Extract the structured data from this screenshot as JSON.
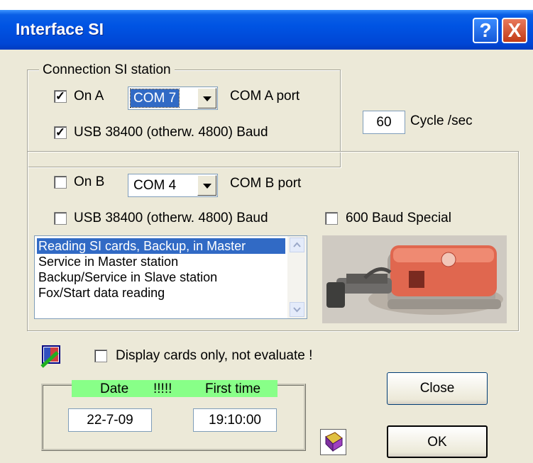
{
  "window": {
    "title": "Interface SI"
  },
  "titlebar_buttons": {
    "help": "?",
    "close": "X"
  },
  "station_group": {
    "label": "Connection SI station"
  },
  "port_a": {
    "checkbox_label": "On A",
    "checked": true,
    "port_value": "COM 7",
    "port_label": "COM A port",
    "usb_label": "USB 38400 (otherw. 4800) Baud",
    "usb_checked": true
  },
  "cycle": {
    "value": "60",
    "label": "Cycle /sec"
  },
  "port_b": {
    "checkbox_label": "On B",
    "checked": false,
    "port_value": "COM 4",
    "port_label": "COM B port",
    "usb_label": "USB 38400 (otherw. 4800) Baud",
    "usb_checked": false,
    "special_label": "600 Baud Special",
    "special_checked": false
  },
  "mode_list": {
    "items": [
      "Reading SI cards, Backup, in Master",
      "Service in Master station",
      "Backup/Service in Slave station",
      "Fox/Start data reading"
    ],
    "selected_index": 0
  },
  "display_only": {
    "label": "Display cards only, not evaluate !",
    "checked": false
  },
  "datetime": {
    "date_header": "Date",
    "separator": "!!!!!",
    "time_header": "First time",
    "date_value": "22-7-09",
    "time_value": "19:10:00"
  },
  "buttons": {
    "close": "Close",
    "ok": "OK"
  },
  "colors": {
    "title_bar": "#0054e3",
    "dialog_bg": "#ece9d8",
    "highlight": "#316ac5",
    "date_header_bg": "#88ff88"
  }
}
